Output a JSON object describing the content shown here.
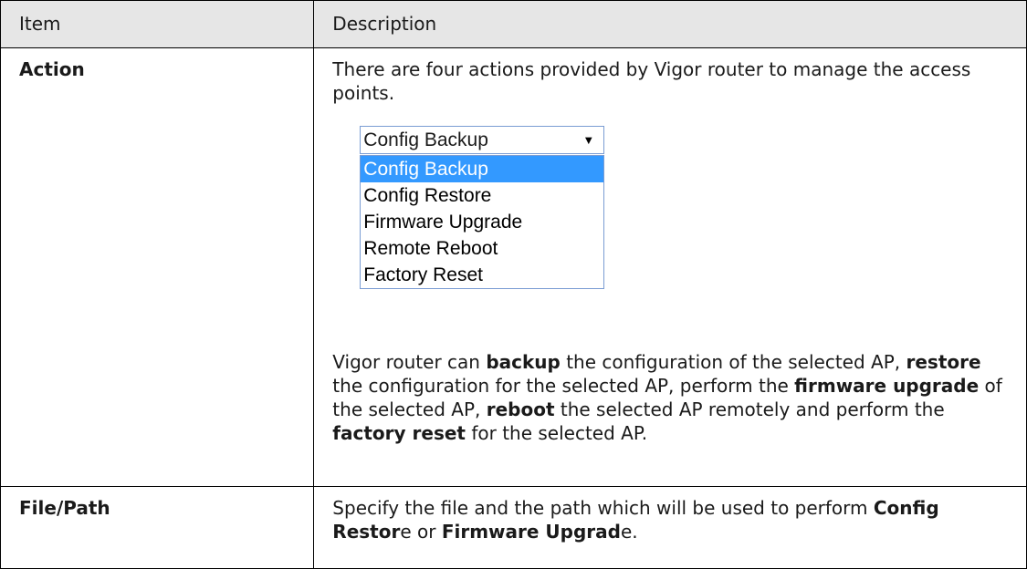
{
  "table": {
    "headers": {
      "item": "Item",
      "description": "Description"
    },
    "rows": [
      {
        "item": "Action",
        "intro": "There are four actions provided by Vigor router to manage the access points.",
        "dropdown": {
          "selected": "Config Backup",
          "options": [
            "Config Backup",
            "Config Restore",
            "Firmware Upgrade",
            "Remote Reboot",
            "Factory Reset"
          ]
        },
        "detail": {
          "t1": "Vigor router can ",
          "b1": "backup",
          "t2": " the configuration of the selected AP, ",
          "b2": "restore",
          "t3": " the configuration for the selected AP, perform the ",
          "b3": "firmware upgrade",
          "t4": " of the selected AP, ",
          "b4": "reboot",
          "t5": " the selected AP remotely and perform the ",
          "b5": "factory reset",
          "t6": " for the selected AP."
        }
      },
      {
        "item": "File/Path",
        "detail": {
          "t1": "Specify the file and the path which will be used to perform ",
          "b1": "Config Restor",
          "t2": "e or ",
          "b2": "Firmware Upgrad",
          "t3": "e."
        }
      }
    ]
  }
}
